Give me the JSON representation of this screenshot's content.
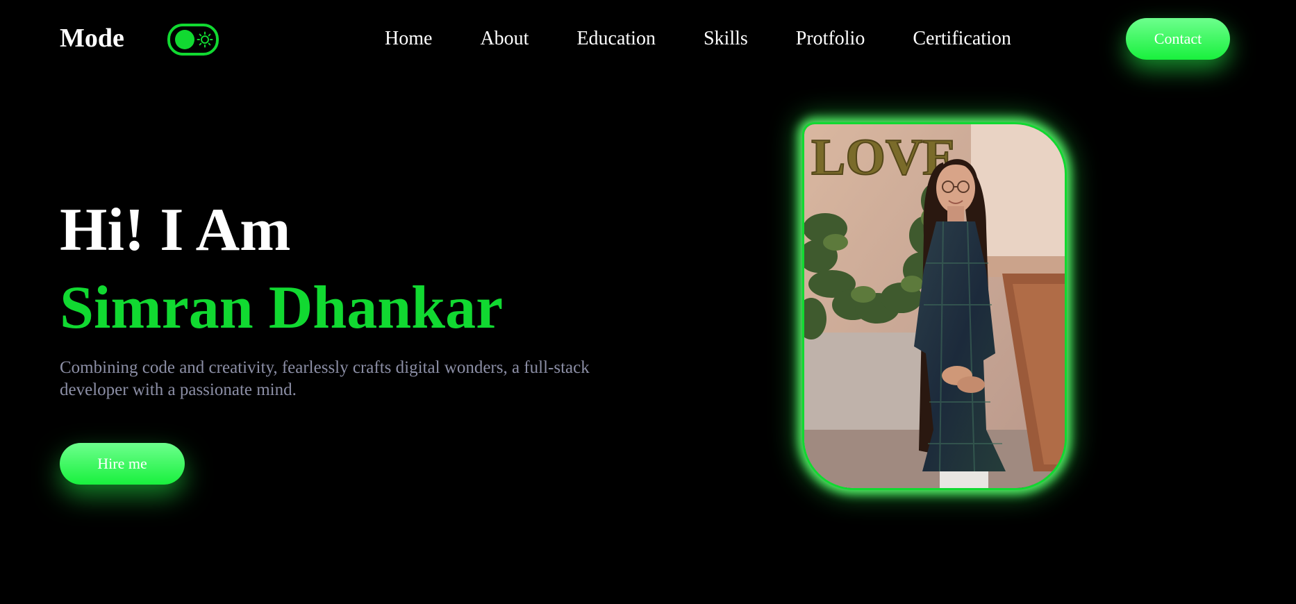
{
  "nav": {
    "brand": "Mode",
    "toggle_icon": "sun-icon",
    "links": [
      "Home",
      "About",
      "Education",
      "Skills",
      "Protfolio",
      "Certification"
    ],
    "contact_label": "Contact"
  },
  "hero": {
    "greeting": "Hi! I Am",
    "name": "Simran Dhankar",
    "tagline": "Combining code and creativity, fearlessly crafts digital wonders, a full-stack developer with a passionate mind.",
    "hire_label": "Hire me",
    "photo_sign_text": "LOVE"
  },
  "colors": {
    "background": "#000000",
    "accent": "#11d931",
    "button_gradient_top": "#6dff8d",
    "button_gradient_bottom": "#19f03d",
    "heading": "#ffffff",
    "tagline": "#8c8fa6"
  }
}
